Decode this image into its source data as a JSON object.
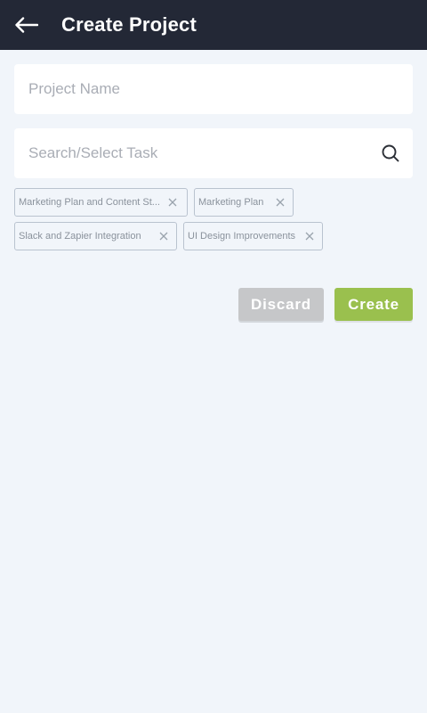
{
  "header": {
    "title": "Create Project",
    "back_icon": "arrow-left-icon"
  },
  "form": {
    "project_name": {
      "value": "",
      "placeholder": "Project Name"
    },
    "task_search": {
      "value": "",
      "placeholder": "Search/Select Task",
      "icon": "search-icon"
    }
  },
  "selected_tasks": [
    {
      "label": "Marketing Plan and Content St..."
    },
    {
      "label": "Marketing Plan"
    },
    {
      "label": "Slack and Zapier Integration"
    },
    {
      "label": "UI Design Improvements"
    }
  ],
  "actions": {
    "discard_label": "Discard",
    "create_label": "Create"
  },
  "colors": {
    "header_bg": "#232836",
    "page_bg": "#f1f5fa",
    "create_button": "#9ac04e",
    "discard_button": "#c6c7c9"
  }
}
